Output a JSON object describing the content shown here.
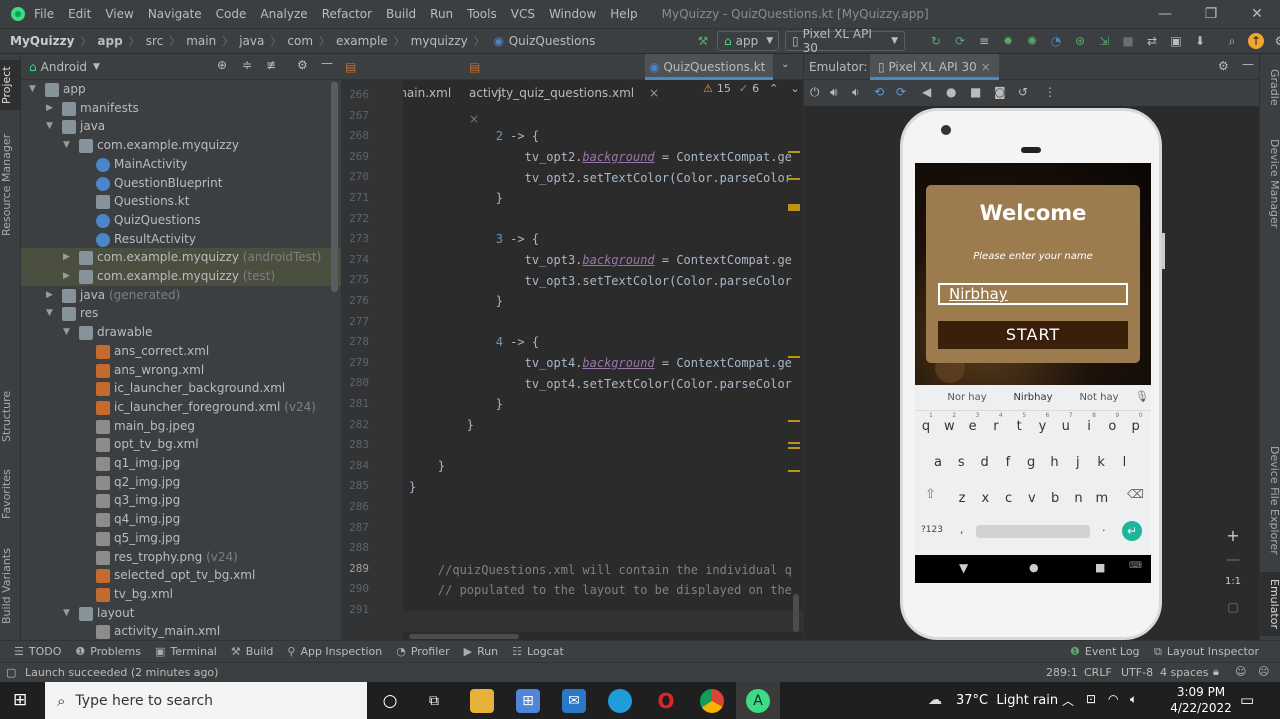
{
  "window": {
    "title": "MyQuizzy - QuizQuestions.kt [MyQuizzy.app]",
    "menu": [
      "File",
      "Edit",
      "View",
      "Navigate",
      "Code",
      "Analyze",
      "Refactor",
      "Build",
      "Run",
      "Tools",
      "VCS",
      "Window",
      "Help"
    ]
  },
  "breadcrumb": [
    "MyQuizzy",
    "app",
    "src",
    "main",
    "java",
    "com",
    "example",
    "myquizzy",
    "QuizQuestions"
  ],
  "toolbar": {
    "run_config": "app",
    "device": "Pixel XL API 30"
  },
  "project": {
    "view": "Android",
    "items": [
      {
        "label": "app",
        "suffix": ""
      },
      {
        "label": "manifests",
        "suffix": ""
      },
      {
        "label": "java",
        "suffix": ""
      },
      {
        "label": "com.example.myquizzy",
        "suffix": ""
      },
      {
        "label": "MainActivity",
        "suffix": ""
      },
      {
        "label": "QuestionBlueprint",
        "suffix": ""
      },
      {
        "label": "Questions.kt",
        "suffix": ""
      },
      {
        "label": "QuizQuestions",
        "suffix": ""
      },
      {
        "label": "ResultActivity",
        "suffix": ""
      },
      {
        "label": "com.example.myquizzy",
        "suffix": "(androidTest)"
      },
      {
        "label": "com.example.myquizzy",
        "suffix": "(test)"
      },
      {
        "label": "java",
        "suffix": "(generated)"
      },
      {
        "label": "res",
        "suffix": ""
      },
      {
        "label": "drawable",
        "suffix": ""
      },
      {
        "label": "ans_correct.xml",
        "suffix": ""
      },
      {
        "label": "ans_wrong.xml",
        "suffix": ""
      },
      {
        "label": "ic_launcher_background.xml",
        "suffix": ""
      },
      {
        "label": "ic_launcher_foreground.xml",
        "suffix": "(v24)"
      },
      {
        "label": "main_bg.jpeg",
        "suffix": ""
      },
      {
        "label": "opt_tv_bg.xml",
        "suffix": ""
      },
      {
        "label": "q1_img.jpg",
        "suffix": ""
      },
      {
        "label": "q2_img.jpg",
        "suffix": ""
      },
      {
        "label": "q3_img.jpg",
        "suffix": ""
      },
      {
        "label": "q4_img.jpg",
        "suffix": ""
      },
      {
        "label": "q5_img.jpg",
        "suffix": ""
      },
      {
        "label": "res_trophy.png",
        "suffix": "(v24)"
      },
      {
        "label": "selected_opt_tv_bg.xml",
        "suffix": ""
      },
      {
        "label": "tv_bg.xml",
        "suffix": ""
      },
      {
        "label": "layout",
        "suffix": ""
      },
      {
        "label": "activity_main.xml",
        "suffix": ""
      }
    ]
  },
  "tabs": [
    "activity_main.xml",
    "activity_quiz_questions.xml",
    "QuizQuestions.kt"
  ],
  "inspections": {
    "warnings": "15",
    "ok": "6"
  },
  "code": {
    "line_numbers": [
      "266",
      "267",
      "268",
      "269",
      "270",
      "271",
      "272",
      "273",
      "274",
      "275",
      "276",
      "277",
      "278",
      "279",
      "280",
      "281",
      "282",
      "283",
      "284",
      "285",
      "286",
      "287",
      "288",
      "289",
      "290",
      "291"
    ]
  },
  "emulator": {
    "label": "Emulator:",
    "tab": "Pixel XL API 30"
  },
  "app": {
    "welcome": "Welcome",
    "prompt": "Please enter your name",
    "name": "Nirbhay",
    "start": "START"
  },
  "keyboard": {
    "suggestions": [
      "Nor hay",
      "Nirbhay",
      "Not hay"
    ],
    "row1": [
      "q",
      "w",
      "e",
      "r",
      "t",
      "y",
      "u",
      "i",
      "o",
      "p"
    ],
    "row1_hints": [
      "1",
      "2",
      "3",
      "4",
      "5",
      "6",
      "7",
      "8",
      "9",
      "0"
    ],
    "row2": [
      "a",
      "s",
      "d",
      "f",
      "g",
      "h",
      "j",
      "k",
      "l"
    ],
    "row3": [
      "z",
      "x",
      "c",
      "v",
      "b",
      "n",
      "m"
    ],
    "sym": "?123",
    "comma": ",",
    "period": "."
  },
  "emu_side": {
    "zoom": "1:1"
  },
  "bottom_tabs": [
    "TODO",
    "Problems",
    "Terminal",
    "Build",
    "App Inspection",
    "Profiler",
    "Run",
    "Logcat"
  ],
  "bottom_right": [
    "Event Log",
    "Layout Inspector"
  ],
  "status": {
    "message": "Launch succeeded (2 minutes ago)",
    "position": "289:1",
    "line_sep": "CRLF",
    "encoding": "UTF-8",
    "indent": "4 spaces"
  },
  "side_tabs_left": [
    "Project",
    "Resource Manager",
    "Structure",
    "Favorites",
    "Build Variants"
  ],
  "side_tabs_right": [
    "Gradle",
    "Device Manager",
    "Device File Explorer",
    "Emulator"
  ],
  "taskbar": {
    "search_placeholder": "Type here to search",
    "weather": "37°C  Light rain",
    "time": "3:09 PM",
    "date": "4/22/2022"
  }
}
